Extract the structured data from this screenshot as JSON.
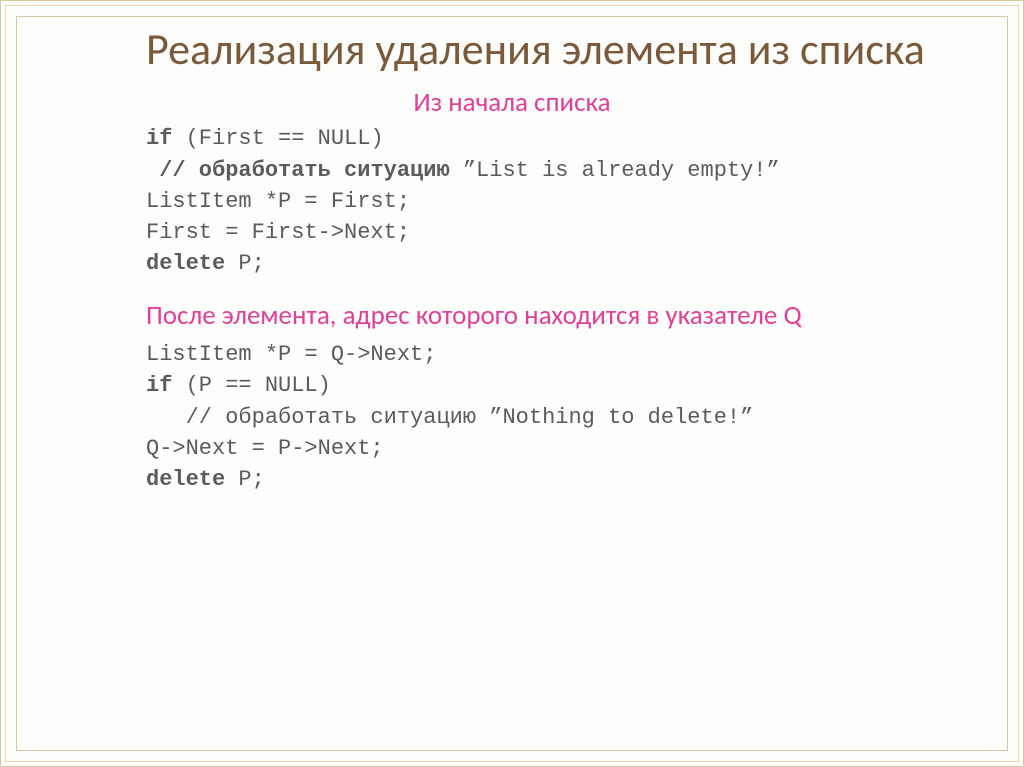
{
  "title": "Реализация удаления элемента из списка",
  "section1": {
    "heading": "Из начала списка",
    "code": [
      {
        "text": "if",
        "bold": true
      },
      {
        "text": " (First == NULL)"
      },
      {
        "text": "\n "
      },
      {
        "text": "// обработать ситуацию",
        "bold": true
      },
      {
        "text": " ”List is already empty!”"
      },
      {
        "text": "\nListItem *P = First;"
      },
      {
        "text": "\nFirst = First->Next;"
      },
      {
        "text": "\n"
      },
      {
        "text": "delete",
        "bold": true
      },
      {
        "text": " P;"
      }
    ]
  },
  "section2": {
    "heading": "После элемента, адрес которого находится в указателе Q",
    "code": [
      {
        "text": "ListItem *P = Q->Next;"
      },
      {
        "text": "\n"
      },
      {
        "text": "if",
        "bold": true
      },
      {
        "text": " (P == NULL)"
      },
      {
        "text": "\n   // обработать ситуацию ”Nothing to delete!”"
      },
      {
        "text": "\nQ->Next = P->Next;"
      },
      {
        "text": "\n"
      },
      {
        "text": "delete",
        "bold": true
      },
      {
        "text": " P;"
      }
    ]
  }
}
